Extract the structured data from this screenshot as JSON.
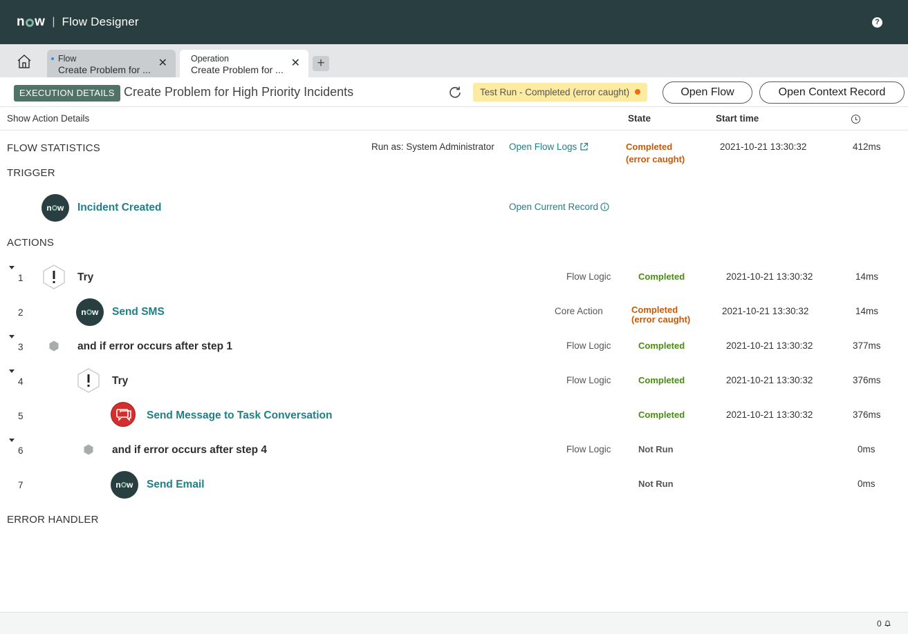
{
  "header": {
    "logo": "now",
    "app_title": "Flow Designer",
    "help_icon": "?"
  },
  "tabs": [
    {
      "kind": "Flow",
      "name": "Create Problem for ..."
    },
    {
      "kind": "Operation",
      "name": "Create Problem for ..."
    }
  ],
  "exec_bar": {
    "badge": "EXECUTION DETAILS",
    "title": "Create Problem for High Priority Incidents",
    "status": "Test Run - Completed (error caught)",
    "open_flow": "Open Flow",
    "open_context": "Open Context Record"
  },
  "columns": {
    "show_action_details": "Show Action Details",
    "state": "State",
    "start_time": "Start time"
  },
  "flow_stats": {
    "label": "FLOW STATISTICS",
    "run_as": "Run as: System Administrator",
    "open_logs": "Open Flow Logs",
    "state_line1": "Completed",
    "state_line2": "(error caught)",
    "start_time": "2021-10-21 13:30:32",
    "duration": "412ms"
  },
  "trigger": {
    "label": "TRIGGER",
    "name": "Incident Created",
    "open_record": "Open Current Record"
  },
  "actions_label": "ACTIONS",
  "steps": [
    {
      "num": "1",
      "name": "Try",
      "type": "Flow Logic",
      "state": "Completed",
      "time": "2021-10-21 13:30:32",
      "dur": "14ms"
    },
    {
      "num": "2",
      "name": "Send SMS",
      "type": "Core Action",
      "state": "Completed",
      "state2": "(error caught)",
      "time": "2021-10-21 13:30:32",
      "dur": "14ms"
    },
    {
      "num": "3",
      "name": "and if error occurs after step 1",
      "type": "Flow Logic",
      "state": "Completed",
      "time": "2021-10-21 13:30:32",
      "dur": "377ms"
    },
    {
      "num": "4",
      "name": "Try",
      "type": "Flow Logic",
      "state": "Completed",
      "time": "2021-10-21 13:30:32",
      "dur": "376ms"
    },
    {
      "num": "5",
      "name": "Send Message to Task Conversation",
      "type": "",
      "state": "Completed",
      "time": "2021-10-21 13:30:32",
      "dur": "376ms"
    },
    {
      "num": "6",
      "name": "and if error occurs after step 4",
      "type": "Flow Logic",
      "state": "Not Run",
      "time": "",
      "dur": "0ms"
    },
    {
      "num": "7",
      "name": "Send Email",
      "type": "",
      "state": "Not Run",
      "time": "",
      "dur": "0ms"
    }
  ],
  "error_handler_label": "ERROR HANDLER",
  "footer": {
    "notification_count": "0"
  },
  "colors": {
    "header_bg": "#293e40",
    "accent_link": "#1f7f86",
    "completed": "#4a8a14",
    "error_caught": "#c5590a",
    "status_pill": "#fdeba2"
  }
}
